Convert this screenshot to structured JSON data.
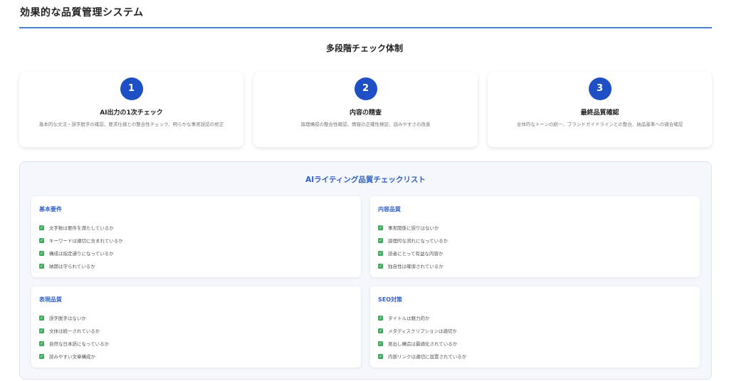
{
  "page": {
    "title": "効果的な品質管理システム"
  },
  "section": {
    "title": "多段階チェック体制"
  },
  "steps": [
    {
      "number": "1",
      "title": "AI出力の1次チェック",
      "description": "基本的な文法・誤字脱字の確認、要求仕様との整合性チェック、明らかな事実誤認の修正"
    },
    {
      "number": "2",
      "title": "内容の精査",
      "description": "論理構成の整合性確認、情報の正確性検証、読みやすさの改善"
    },
    {
      "number": "3",
      "title": "最終品質確認",
      "description": "全体的なトーンの統一、ブランドガイドラインとの整合、納品基準への適合確認"
    }
  ],
  "checklist": {
    "title": "AIライティング品質チェックリスト",
    "groups": [
      {
        "heading": "基本要件",
        "items": [
          "文字数は要件を満たしているか",
          "キーワードは適切に含まれているか",
          "構成は指定通りになっているか",
          "納期は守られているか"
        ]
      },
      {
        "heading": "内容品質",
        "items": [
          "事実関係に誤りはないか",
          "論理的な流れになっているか",
          "読者にとって有益な内容か",
          "独自性は確保されているか"
        ]
      },
      {
        "heading": "表現品質",
        "items": [
          "誤字脱字はないか",
          "文体は統一されているか",
          "自然な日本語になっているか",
          "読みやすい文章構成か"
        ]
      },
      {
        "heading": "SEO対策",
        "items": [
          "タイトルは魅力的か",
          "メタディスクリプションは適切か",
          "見出し構造は最適化されているか",
          "内部リンクは適切に設置されているか"
        ]
      }
    ]
  },
  "colors": {
    "accent": "#1f4fc4",
    "heading_blue": "#2f5fc8",
    "check_green": "#3cae5c",
    "rule": "#4a7fd0"
  },
  "icons": {
    "check": "check-square-icon"
  }
}
